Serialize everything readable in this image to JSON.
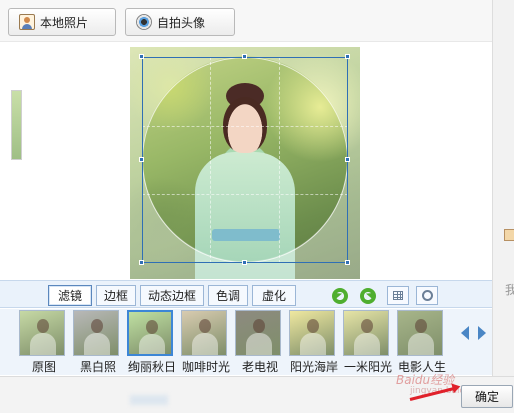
{
  "toolbar": {
    "local_photo_label": "本地照片",
    "selfie_label": "自拍头像"
  },
  "tabs": [
    {
      "label": "滤镜",
      "active": true
    },
    {
      "label": "边框",
      "active": false
    },
    {
      "label": "动态边框",
      "active": false
    },
    {
      "label": "色调",
      "active": false
    },
    {
      "label": "虚化",
      "active": false
    }
  ],
  "tools": {
    "rotate_left_icon": "rotate-left-icon",
    "rotate_right_icon": "rotate-right-icon",
    "grid_icon": "grid-icon",
    "circle_crop_icon": "circle-crop-icon"
  },
  "filters": [
    {
      "label": "原图",
      "selected": false,
      "tone": "#c6d9a5"
    },
    {
      "label": "黑白照",
      "selected": false,
      "tone": "#b8b8b8"
    },
    {
      "label": "绚丽秋日",
      "selected": true,
      "tone": "#bfe0a2"
    },
    {
      "label": "咖啡时光",
      "selected": false,
      "tone": "#d8cbb0"
    },
    {
      "label": "老电视",
      "selected": false,
      "tone": "#8d8a80"
    },
    {
      "label": "阳光海岸",
      "selected": false,
      "tone": "#efe8a0"
    },
    {
      "label": "一米阳光",
      "selected": false,
      "tone": "#e6e4a6"
    },
    {
      "label": "电影人生",
      "selected": false,
      "tone": "#a7b58a"
    }
  ],
  "watermark": {
    "text": "Baidu经验",
    "sub": "jingyan.baidu.com"
  },
  "ok_label": "确定",
  "colors": {
    "accent": "#3c86d6",
    "crop_border": "#2f6fb5",
    "arrow": "#e0202a",
    "rotate_green": "#4fae2f"
  }
}
